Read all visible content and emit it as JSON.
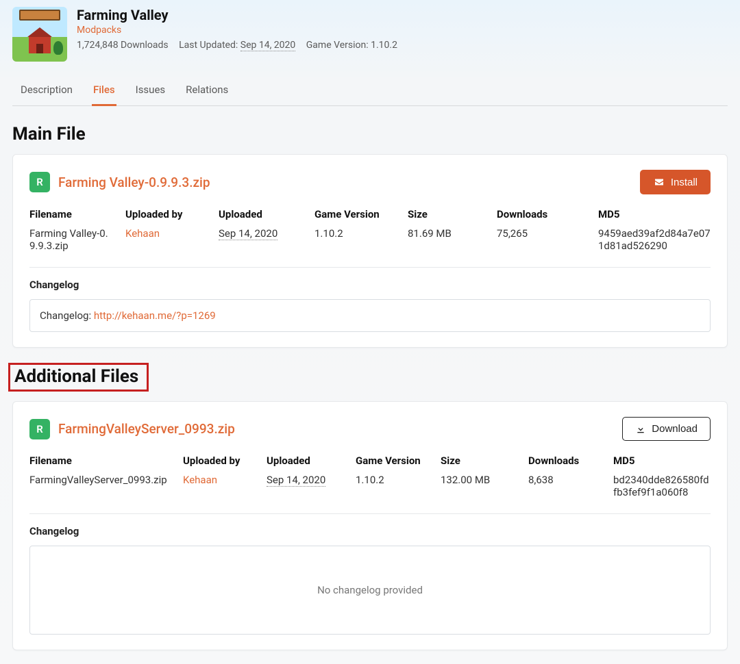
{
  "project": {
    "title": "Farming Valley",
    "category": "Modpacks",
    "downloads_label": "1,724,848 Downloads",
    "last_updated_prefix": "Last Updated:",
    "last_updated_value": "Sep 14, 2020",
    "game_version_prefix": "Game Version:",
    "game_version_value": "1.10.2"
  },
  "tabs": {
    "description": "Description",
    "files": "Files",
    "issues": "Issues",
    "relations": "Relations"
  },
  "sections": {
    "main_file": "Main File",
    "additional_files": "Additional Files"
  },
  "buttons": {
    "install": "Install",
    "download": "Download"
  },
  "headers": {
    "filename": "Filename",
    "uploaded_by": "Uploaded by",
    "uploaded": "Uploaded",
    "game_version": "Game Version",
    "size": "Size",
    "downloads": "Downloads",
    "md5": "MD5",
    "changelog": "Changelog"
  },
  "main_file": {
    "badge": "R",
    "title_link": "Farming Valley-0.9.9.3.zip",
    "filename": "Farming Valley-0.9.9.3.zip",
    "uploaded_by": "Kehaan",
    "uploaded": "Sep 14, 2020",
    "game_version": "1.10.2",
    "size": "81.69 MB",
    "downloads": "75,265",
    "md5": "9459aed39af2d84a7e071d81ad526290",
    "changelog_prefix": "Changelog: ",
    "changelog_link": "http://kehaan.me/?p=1269"
  },
  "additional_file": {
    "badge": "R",
    "title_link": "FarmingValleyServer_0993.zip",
    "filename": "FarmingValleyServer_0993.zip",
    "uploaded_by": "Kehaan",
    "uploaded": "Sep 14, 2020",
    "game_version": "1.10.2",
    "size": "132.00 MB",
    "downloads": "8,638",
    "md5": "bd2340dde826580fdfb3fef9f1a060f8",
    "changelog_empty": "No changelog provided"
  }
}
